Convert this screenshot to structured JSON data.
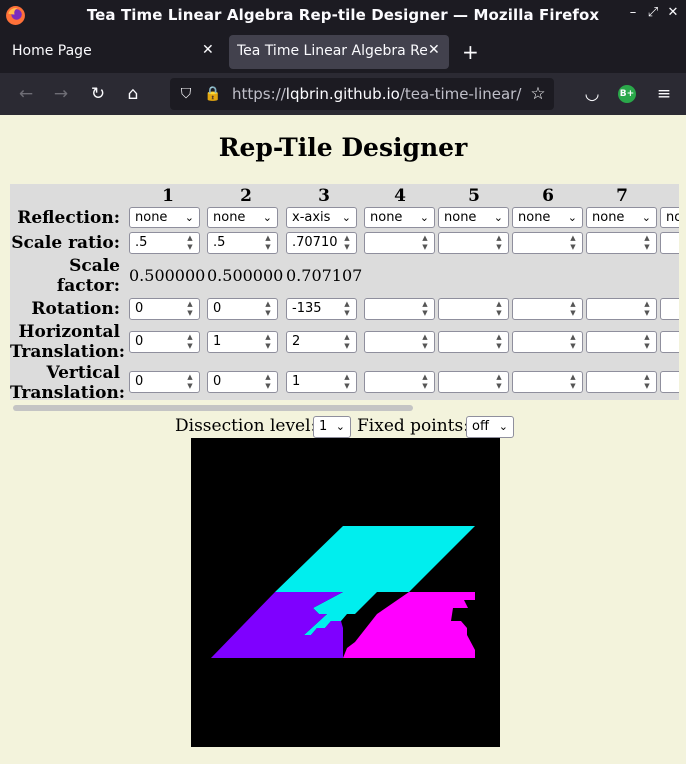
{
  "window": {
    "title": "Tea Time Linear Algebra Rep-tile Designer — Mozilla Firefox"
  },
  "tabs": [
    {
      "label": "Home Page"
    },
    {
      "label": "Tea Time Linear Algebra Rep"
    }
  ],
  "navbar": {
    "url_prefix": "https://",
    "url_host": "lqbrin.github.io",
    "url_path": "/tea-time-linear/rep",
    "extension_badge": "B+"
  },
  "page": {
    "title": "Rep-Tile Designer",
    "row_labels": {
      "reflection": "Reflection:",
      "scale_ratio": "Scale ratio:",
      "scale_factor_1": "Scale",
      "scale_factor_2": "factor:",
      "rotation": "Rotation:",
      "htrans_1": "Horizontal",
      "htrans_2": "Translation:",
      "vtrans_1": "Vertical",
      "vtrans_2": "Translation:"
    },
    "columns": [
      {
        "head": "1",
        "reflection": "none",
        "scale_ratio": ".5",
        "scale_factor": "0.500000",
        "rotation": "0",
        "htrans": "0",
        "vtrans": "0"
      },
      {
        "head": "2",
        "reflection": "none",
        "scale_ratio": ".5",
        "scale_factor": "0.500000",
        "rotation": "0",
        "htrans": "1",
        "vtrans": "0"
      },
      {
        "head": "3",
        "reflection": "x-axis",
        "scale_ratio": ".70710",
        "scale_factor": "0.707107",
        "rotation": "-135",
        "htrans": "2",
        "vtrans": "1"
      },
      {
        "head": "4",
        "reflection": "none",
        "scale_ratio": "",
        "scale_factor": "",
        "rotation": "",
        "htrans": "",
        "vtrans": ""
      },
      {
        "head": "5",
        "reflection": "none",
        "scale_ratio": "",
        "scale_factor": "",
        "rotation": "",
        "htrans": "",
        "vtrans": ""
      },
      {
        "head": "6",
        "reflection": "none",
        "scale_ratio": "",
        "scale_factor": "",
        "rotation": "",
        "htrans": "",
        "vtrans": ""
      },
      {
        "head": "7",
        "reflection": "none",
        "scale_ratio": "",
        "scale_factor": "",
        "rotation": "",
        "htrans": "",
        "vtrans": ""
      },
      {
        "head": "",
        "reflection": "no",
        "scale_ratio": "",
        "scale_factor": "",
        "rotation": "",
        "htrans": "",
        "vtrans": ""
      }
    ],
    "dissection_label": "Dissection level:",
    "dissection_value": "1",
    "fixed_points_label": "Fixed points:",
    "fixed_points_value": "off"
  },
  "colors": {
    "page_bg": "#f3f3dc",
    "tile_cyan": "#00eeee",
    "tile_violet": "#7f00ff",
    "tile_magenta": "#ff00ff"
  }
}
